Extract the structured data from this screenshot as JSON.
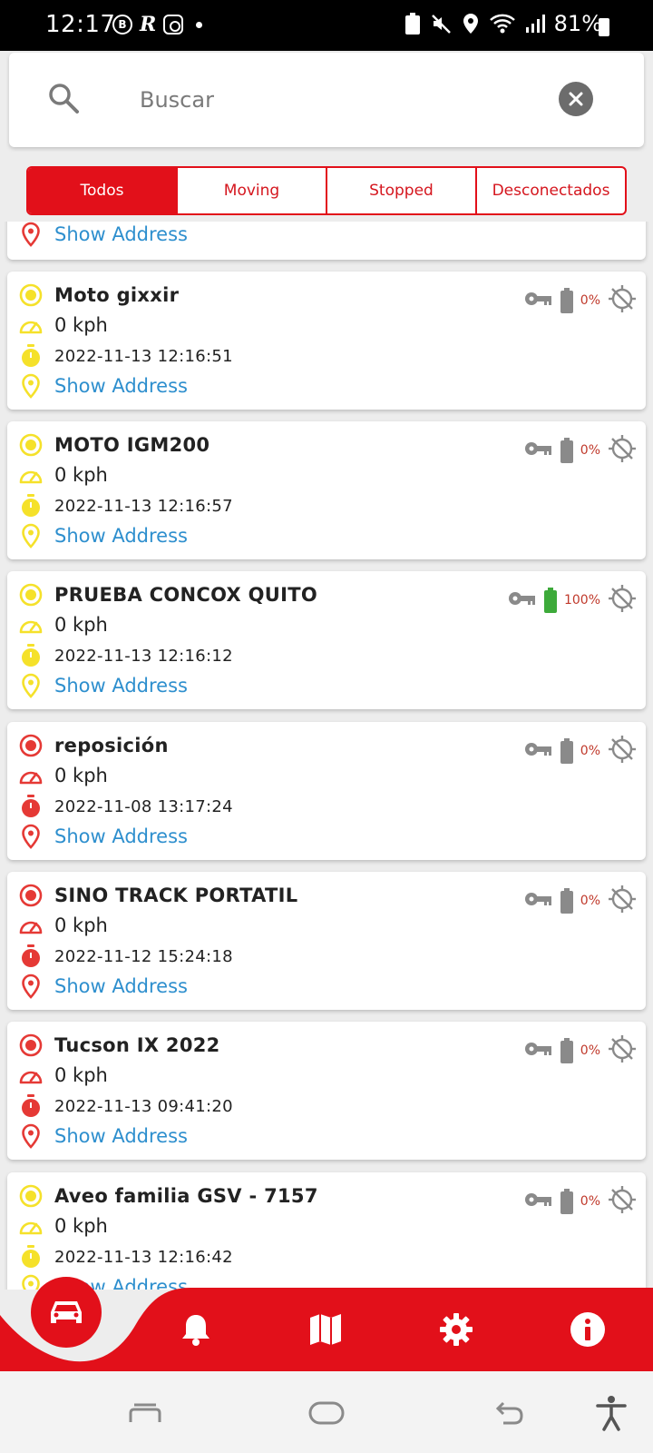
{
  "status_bar": {
    "time": "12:17",
    "battery": "81%",
    "left_icons": [
      "b-circle-icon",
      "r-app-icon",
      "instagram-icon",
      "dot-icon"
    ],
    "right_icons": [
      "recycle-icon",
      "mute-icon",
      "location-icon",
      "wifi-icon",
      "signal-icon",
      "battery-icon"
    ]
  },
  "search": {
    "placeholder": "Buscar",
    "value": ""
  },
  "tabs": [
    {
      "label": "Todos",
      "active": true
    },
    {
      "label": "Moving",
      "active": false
    },
    {
      "label": "Stopped",
      "active": false
    },
    {
      "label": "Desconectados",
      "active": false
    }
  ],
  "partial_card": {
    "address_label": "Show Address",
    "status": "red"
  },
  "vehicles": [
    {
      "name": "Moto gixxir",
      "speed": "0 kph",
      "time": "2022-11-13 12:16:51",
      "address_label": "Show Address",
      "status": "yellow",
      "battery_pct": "0%",
      "battery_level": 0
    },
    {
      "name": "MOTO IGM200",
      "speed": "0 kph",
      "time": "2022-11-13 12:16:57",
      "address_label": "Show Address",
      "status": "yellow",
      "battery_pct": "0%",
      "battery_level": 0
    },
    {
      "name": "PRUEBA CONCOX QUITO",
      "speed": "0 kph",
      "time": "2022-11-13 12:16:12",
      "address_label": "Show Address",
      "status": "yellow",
      "battery_pct": "100%",
      "battery_level": 1
    },
    {
      "name": "reposición",
      "speed": "0 kph",
      "time": "2022-11-08 13:17:24",
      "address_label": "Show Address",
      "status": "red",
      "battery_pct": "0%",
      "battery_level": 0
    },
    {
      "name": "SINO TRACK PORTATIL",
      "speed": "0 kph",
      "time": "2022-11-12 15:24:18",
      "address_label": "Show Address",
      "status": "red",
      "battery_pct": "0%",
      "battery_level": 0
    },
    {
      "name": "Tucson IX 2022",
      "speed": "0 kph",
      "time": "2022-11-13 09:41:20",
      "address_label": "Show Address",
      "status": "red",
      "battery_pct": "0%",
      "battery_level": 0
    },
    {
      "name": "Aveo familia GSV - 7157",
      "speed": "0 kph",
      "time": "2022-11-13 12:16:42",
      "address_label": "Show Address",
      "status": "yellow",
      "battery_pct": "0%",
      "battery_level": 0
    }
  ],
  "bottom_nav": {
    "items": [
      "car-icon",
      "bell-icon",
      "map-icon",
      "gear-icon",
      "info-icon"
    ],
    "active": "car-icon"
  },
  "system_nav": [
    "recent-apps-icon",
    "home-icon",
    "back-icon",
    "accessibility-icon"
  ],
  "colors": {
    "accent": "#e2101a",
    "status_yellow": "#f5e12a",
    "status_red": "#e53935",
    "link_blue": "#2e8fce",
    "battery_full": "#3daa3a",
    "battery_empty": "#8a8a8a",
    "icon_gray": "#8a8a8a"
  }
}
